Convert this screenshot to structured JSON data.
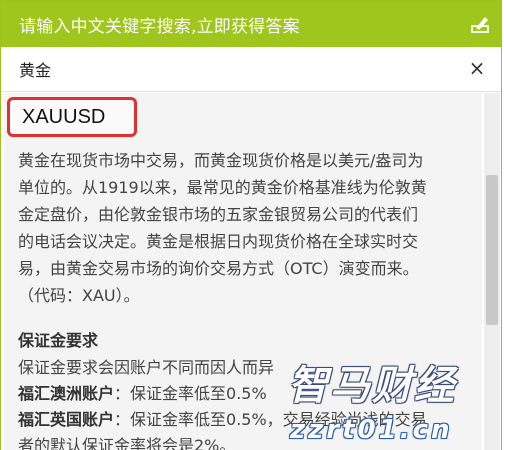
{
  "header": {
    "title": "请输入中文关键字搜索,立即获得答案",
    "edit_icon": "edit-icon",
    "color": "#9fc61d"
  },
  "search": {
    "value": "黄金",
    "clear_icon": "close-icon",
    "clear_glyph": "×"
  },
  "result": {
    "symbol": "XAUUSD",
    "highlight_color": "#e03030",
    "description_lines": [
      "黄金在现货市场中交易，而黄金现货价格是以美元/盎司为",
      "单位的。从1919以来，最常见的黄金价格基准线为伦敦黄",
      "金定盘价，由伦敦金银市场的五家金银贸易公司的代表们",
      "的电话会议决定。黄金是根据日内现货价格在全球实时交",
      "易，由黄金交易市场的询价交易方式（OTC）演变而来。",
      "（代码：XAU）。"
    ],
    "margin_section": {
      "title": "保证金要求",
      "intro": "保证金要求会因账户不同而因人而异",
      "accounts": [
        {
          "name": "福汇澳洲账户",
          "text": "：保证金率低至0.5%"
        },
        {
          "name": "福汇英国账户",
          "text": "：保证金率低至0.5%，交易经验尚浅的交易"
        }
      ],
      "cut_line": "者的默认保证金率将会是2%。"
    }
  },
  "watermark": {
    "brand": "智马财经",
    "url": "zzrt01.cn"
  }
}
